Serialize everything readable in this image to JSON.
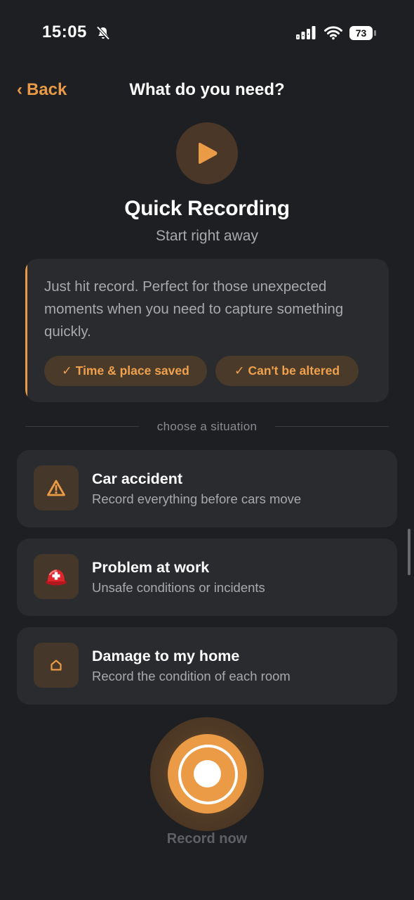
{
  "status_bar": {
    "time": "15:05",
    "battery": "73"
  },
  "nav": {
    "back_label": "Back",
    "title": "What do you need?"
  },
  "hero": {
    "title": "Quick Recording",
    "subtitle": "Start right away"
  },
  "info": {
    "text": "Just hit record. Perfect for those unexpected moments when you need to capture something quickly.",
    "chips": [
      "✓ Time & place saved",
      "✓ Can't be altered"
    ]
  },
  "divider_label": "choose a situation",
  "situations": [
    {
      "title": "Car accident",
      "subtitle": "Record everything before cars move",
      "icon": "warning-icon"
    },
    {
      "title": "Problem at work",
      "subtitle": "Unsafe conditions or incidents",
      "icon": "helmet-icon"
    },
    {
      "title": "Damage to my home",
      "subtitle": "Record the condition of each room",
      "icon": "home-icon"
    }
  ],
  "record": {
    "label": "Record now"
  },
  "colors": {
    "accent": "#e89a47",
    "background": "#1e1f22",
    "card": "#2a2b2f"
  }
}
